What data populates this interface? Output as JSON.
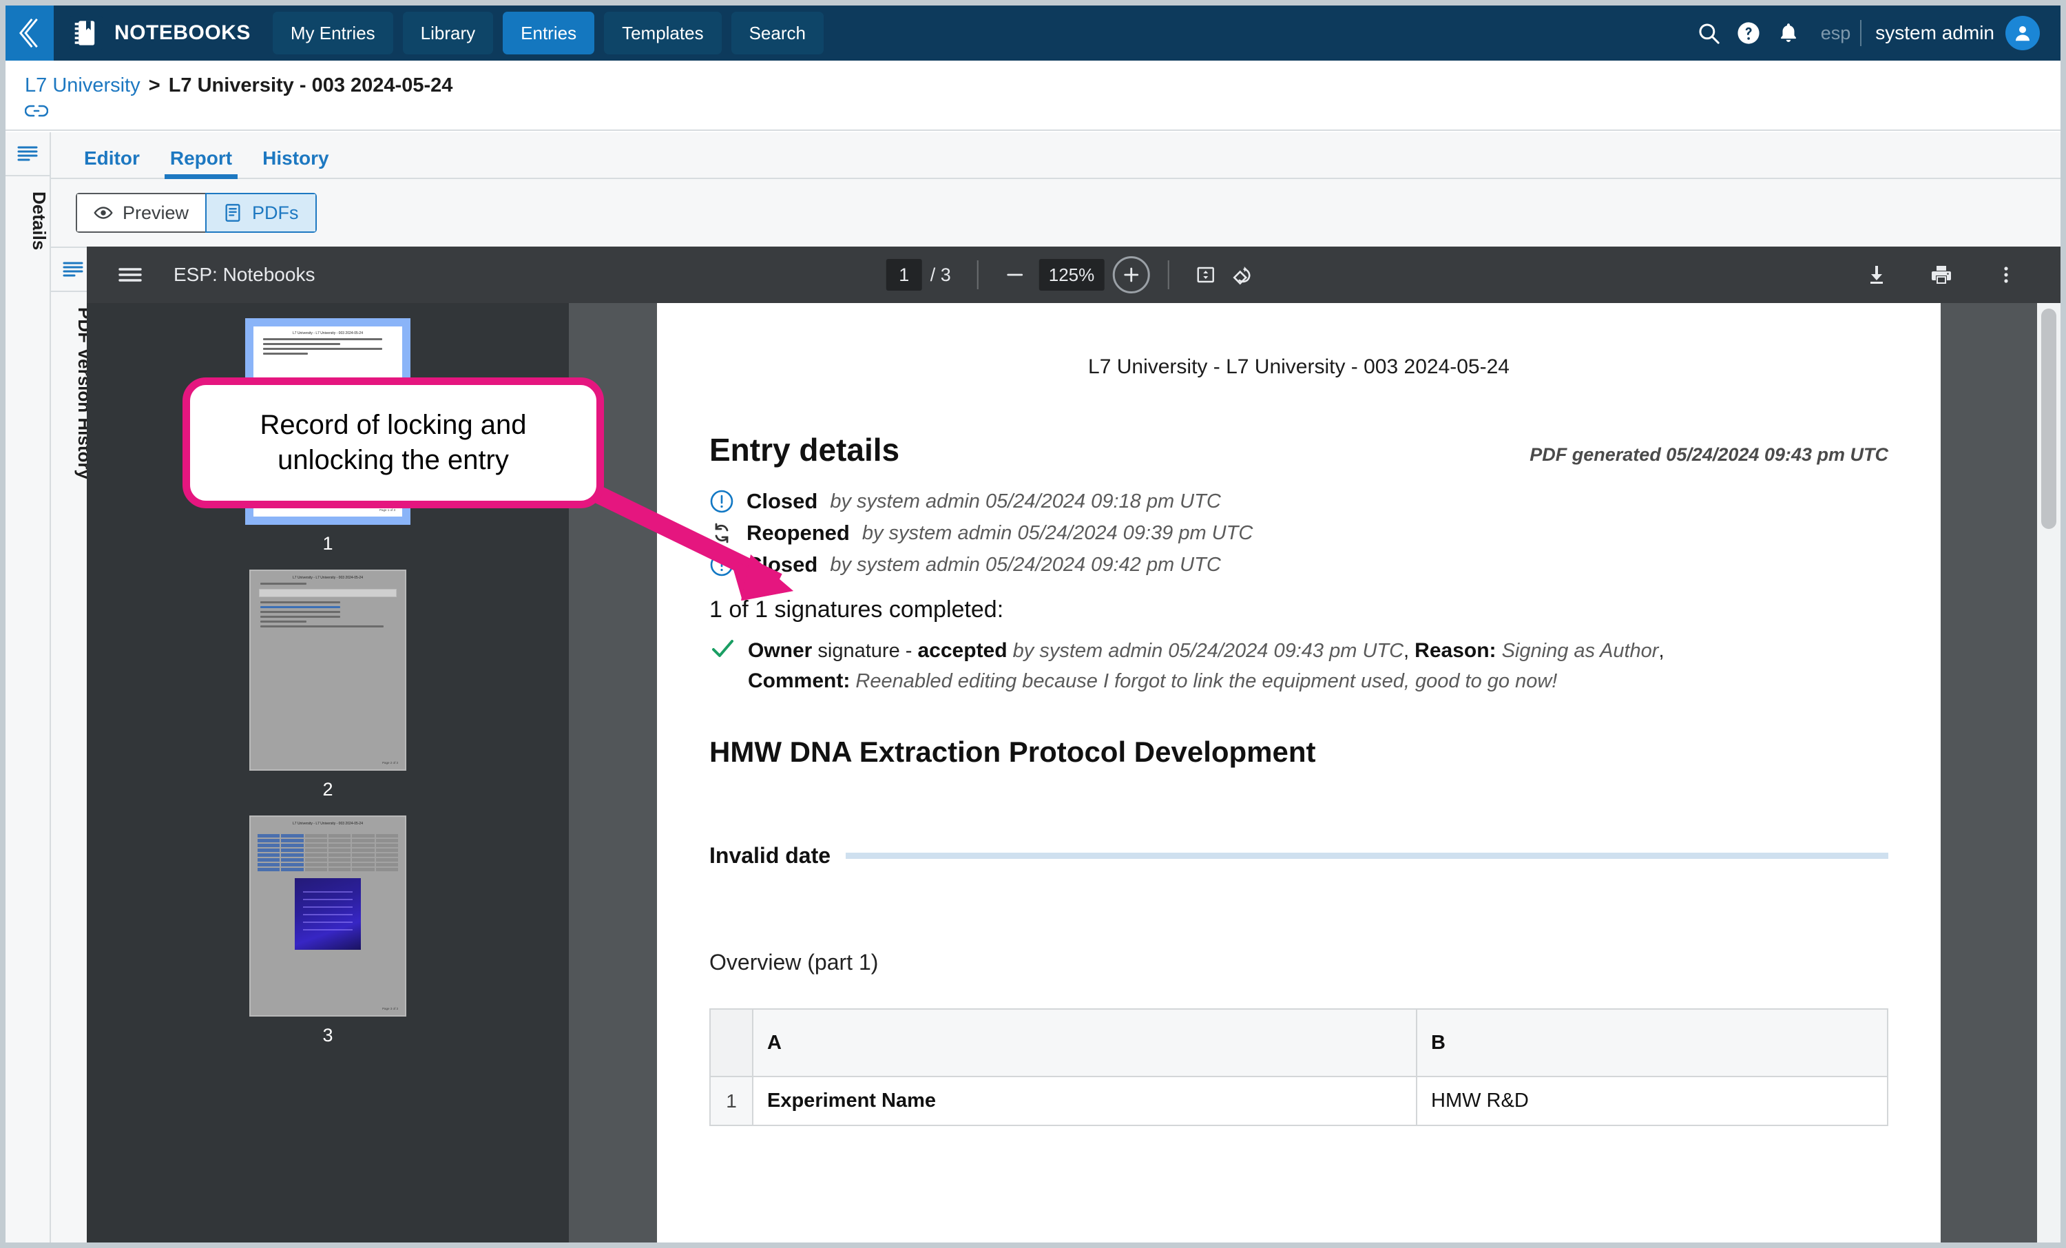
{
  "topnav": {
    "back_icon": "chevrons-left-icon",
    "brand": "NOTEBOOKS",
    "brand_icon": "notebook-icon",
    "tabs": [
      {
        "label": "My Entries",
        "active": false
      },
      {
        "label": "Library",
        "active": false
      },
      {
        "label": "Entries",
        "active": true
      },
      {
        "label": "Templates",
        "active": false
      },
      {
        "label": "Search",
        "active": false
      }
    ],
    "icons": [
      "search-icon",
      "help-icon",
      "notifications-icon"
    ],
    "tenant": "esp",
    "username": "system admin",
    "avatar_icon": "user-avatar-icon"
  },
  "breadcrumb": {
    "parent": "L7 University",
    "separator": ">",
    "current": "L7 University - 003 2024-05-24",
    "link_icon": "link-icon"
  },
  "rails": {
    "details_label": "Details",
    "pdf_history_label": "PDF Version History",
    "menu_icon": "list-menu-icon"
  },
  "tabstrip": {
    "tabs": [
      {
        "label": "Editor",
        "active": false
      },
      {
        "label": "Report",
        "active": true
      },
      {
        "label": "History",
        "active": false
      }
    ]
  },
  "toggle": {
    "preview_label": "Preview",
    "preview_icon": "eye-icon",
    "pdfs_label": "PDFs",
    "pdfs_icon": "document-icon"
  },
  "pdf_toolbar": {
    "menu_icon": "hamburger-icon",
    "title": "ESP: Notebooks",
    "page_current": "1",
    "page_total": "/ 3",
    "zoom_out_icon": "minus-icon",
    "zoom_level": "125%",
    "zoom_in_icon": "plus-icon",
    "fit_icon": "fit-page-icon",
    "rotate_icon": "rotate-icon",
    "download_icon": "download-icon",
    "print_icon": "print-icon",
    "more_icon": "more-vertical-icon"
  },
  "thumbnails": [
    {
      "label": "1",
      "selected": true
    },
    {
      "label": "2",
      "selected": false
    },
    {
      "label": "3",
      "selected": false
    }
  ],
  "thumb_text": {
    "header": "L7 University - L7 University - 003 2024-05-24",
    "footer1": "Page 1 of 3",
    "footer2": "Page 2 of 3",
    "footer3": "Page 3 of 3"
  },
  "document": {
    "header": "L7 University - L7 University - 003 2024-05-24",
    "title": "Entry details",
    "generated": "PDF generated 05/24/2024 09:43 pm UTC",
    "statuses": [
      {
        "icon": "alert-circle-icon",
        "label": "Closed",
        "meta": "by system admin 05/24/2024 09:18 pm UTC"
      },
      {
        "icon": "refresh-icon",
        "label": "Reopened",
        "meta": "by system admin 05/24/2024 09:39 pm UTC"
      },
      {
        "icon": "alert-circle-icon",
        "label": "Closed",
        "meta": "by system admin 05/24/2024 09:42 pm UTC"
      }
    ],
    "signatures_heading": "1 of 1 signatures completed:",
    "signature": {
      "check_icon": "check-icon",
      "role": "Owner",
      "word_signature": "signature -",
      "state": "accepted",
      "by": "by system admin 05/24/2024 09:43 pm UTC",
      "comma1": ",",
      "reason_label": "Reason:",
      "reason_value": "Signing as Author",
      "comma2": ",",
      "comment_label": "Comment:",
      "comment_value": "Reenabled editing because I forgot to link the equipment used, good to go now!"
    },
    "section_title": "HMW DNA Extraction Protocol Development",
    "date_text": "Invalid date",
    "overview_title": "Overview (part 1)",
    "table": {
      "headers": [
        "",
        "A",
        "B"
      ],
      "rows": [
        {
          "num": "1",
          "a": "Experiment Name",
          "b": "HMW R&D"
        }
      ]
    }
  },
  "callout": {
    "text_line1": "Record of locking and",
    "text_line2": "unlocking the entry",
    "color": "#e5167f"
  },
  "colors": {
    "nav_bg": "#0d3a5c",
    "accent_blue": "#1477bf",
    "link_blue": "#1d78c1",
    "pdf_bg": "#525659",
    "pdf_toolbar": "#393c3f",
    "thumb_pane": "#323639",
    "selected_thumb": "#8ab4f8",
    "callout_pink": "#e5167f",
    "check_green": "#1a9e63"
  }
}
